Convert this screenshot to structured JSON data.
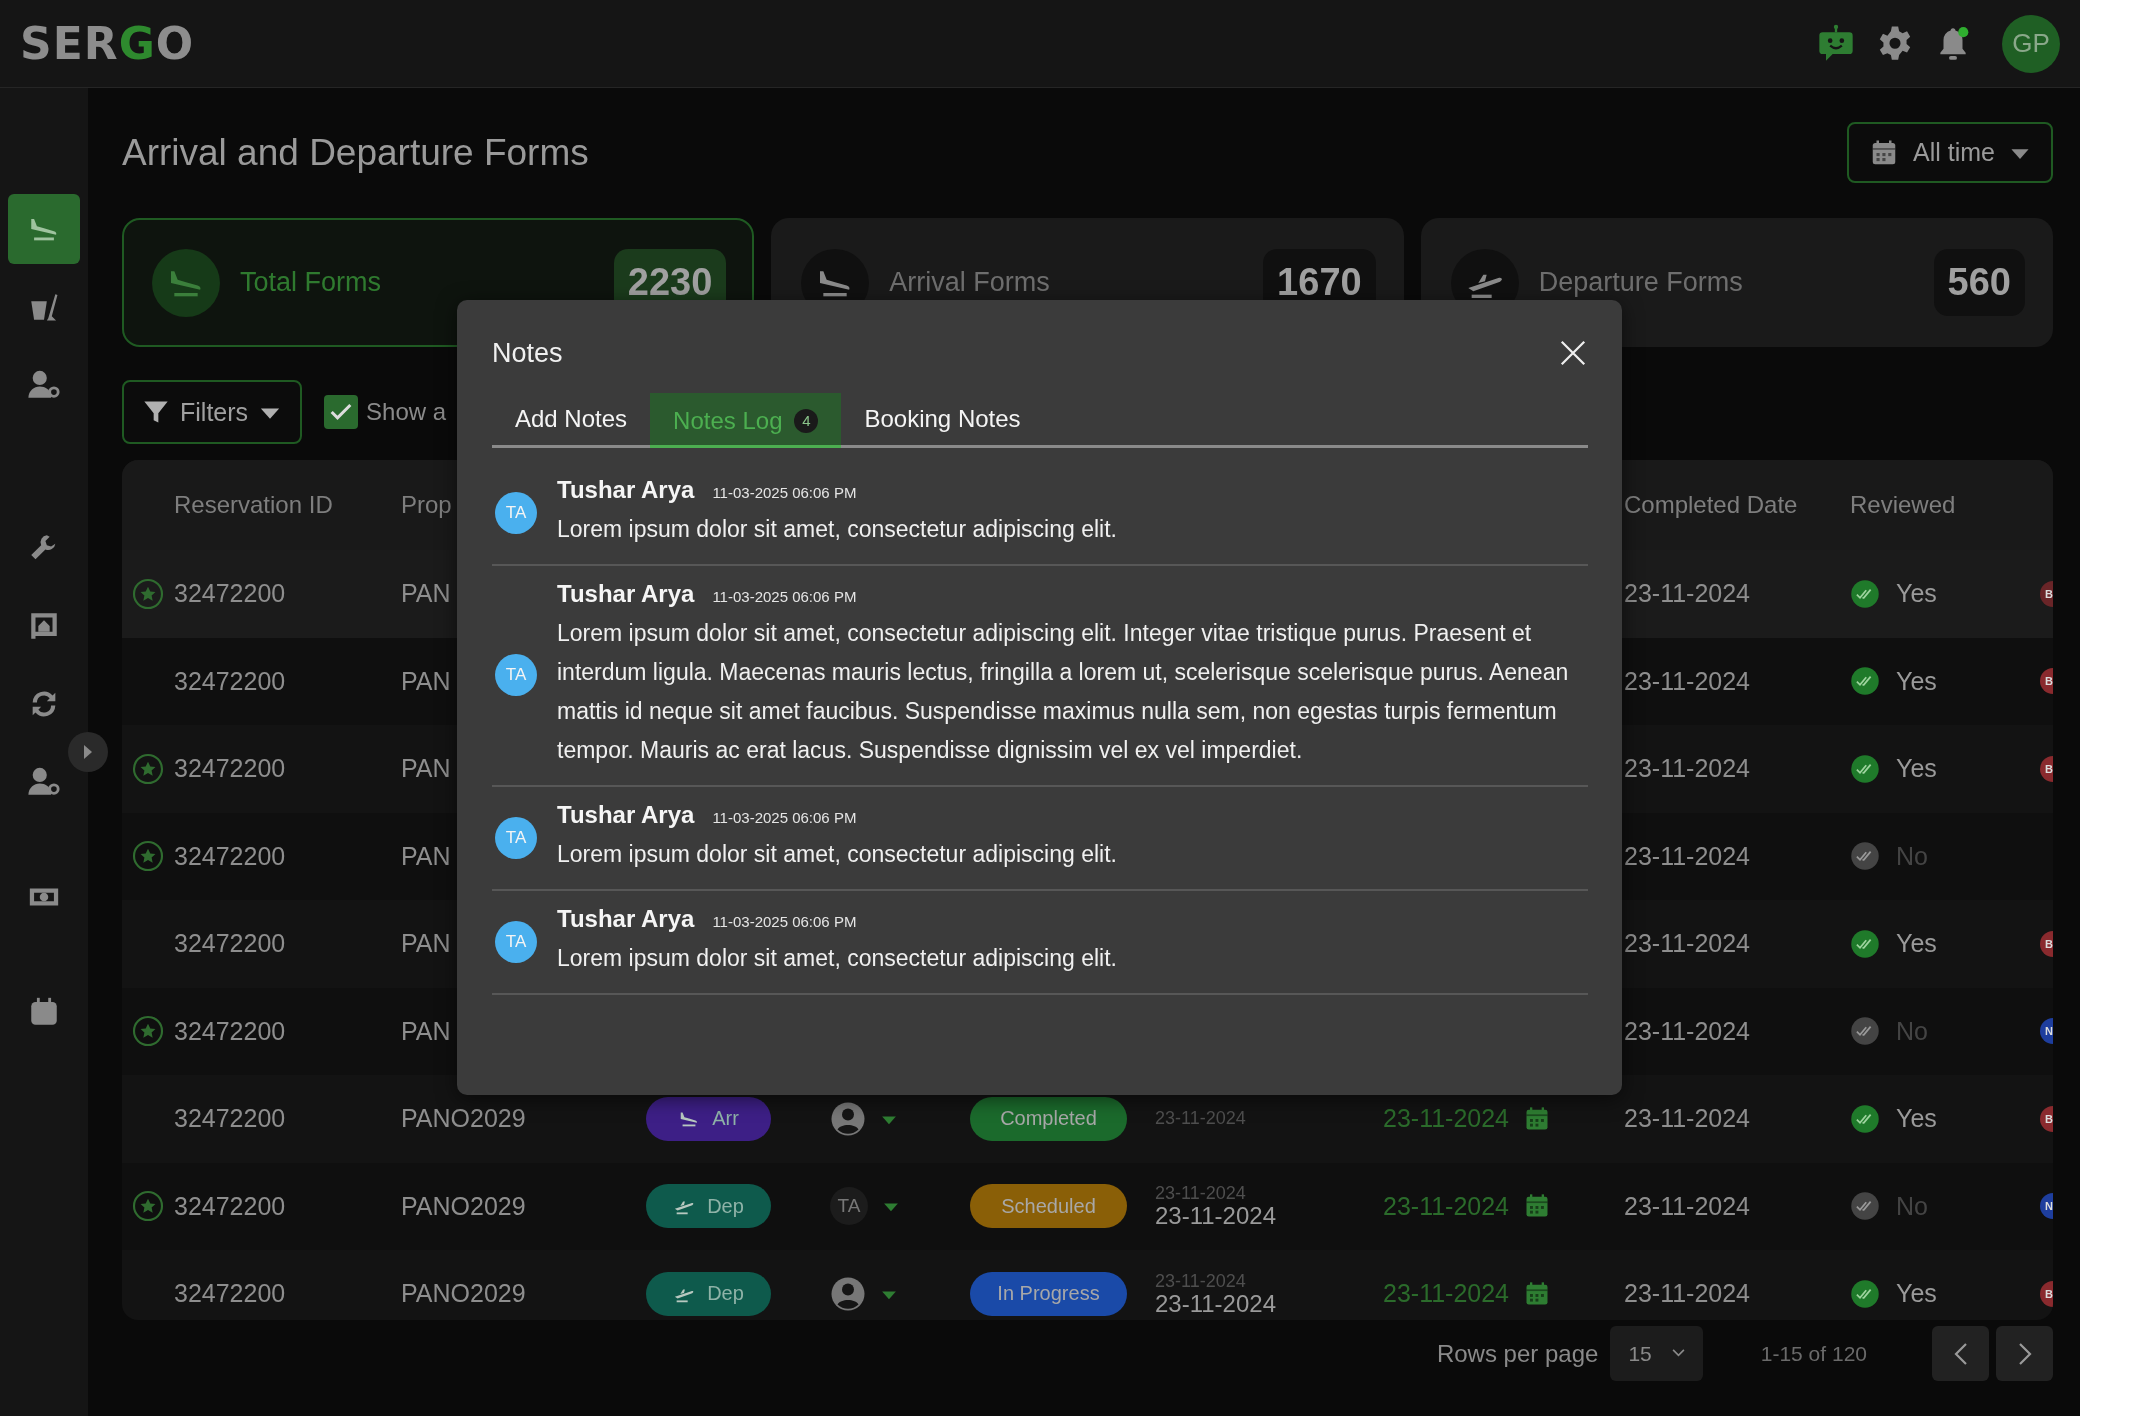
{
  "brand": {
    "logo_parts": [
      {
        "text": "SER",
        "accent": false
      },
      {
        "text": "G",
        "accent": true
      },
      {
        "text": "O",
        "accent": false
      }
    ]
  },
  "header": {
    "notification_dot": true,
    "user_initials": "GP"
  },
  "sidebar": {
    "groups": [
      [
        {
          "kind": "arrival",
          "selected": true
        },
        {
          "kind": "cleaning",
          "selected": false
        },
        {
          "kind": "staff",
          "selected": false
        }
      ],
      [
        {
          "kind": "maintenance",
          "selected": false
        },
        {
          "kind": "property",
          "selected": false
        },
        {
          "kind": "sync",
          "selected": false
        },
        {
          "kind": "staff",
          "selected": false
        }
      ],
      [
        {
          "kind": "payment",
          "selected": false
        }
      ],
      [
        {
          "kind": "calendar",
          "selected": false
        }
      ]
    ]
  },
  "page_title": "Arrival and Departure Forms",
  "date_filter": {
    "label": "All time"
  },
  "stats": [
    {
      "kind": "total",
      "label": "Total Forms",
      "count": "2230",
      "selected": true
    },
    {
      "kind": "arrival",
      "label": "Arrival Forms",
      "count": "1670",
      "selected": false
    },
    {
      "kind": "departure",
      "label": "Departure Forms",
      "count": "560",
      "selected": false
    }
  ],
  "toolbar": {
    "filters_label": "Filters",
    "show_all": {
      "label": "Show a",
      "checked": true
    }
  },
  "table": {
    "columns": [
      "Reservation ID",
      "Prop",
      "Completed Date",
      "Reviewed"
    ],
    "rows": [
      {
        "highlighted": true,
        "starred": true,
        "id": "32472200",
        "property": "PAN",
        "completed": "23-11-2024",
        "reviewed": {
          "label": "Yes",
          "checked": true
        },
        "badge": {
          "text": "B",
          "color": "#6a2528"
        }
      },
      {
        "highlighted": false,
        "starred": false,
        "id": "32472200",
        "property": "PAN",
        "completed": "23-11-2024",
        "reviewed": {
          "label": "Yes",
          "checked": true
        },
        "badge": {
          "text": "B",
          "color": "#8a2a2e"
        }
      },
      {
        "highlighted": false,
        "starred": true,
        "id": "32472200",
        "property": "PAN",
        "completed": "23-11-2024",
        "reviewed": {
          "label": "Yes",
          "checked": true
        },
        "badge": {
          "text": "B",
          "color": "#8a2a2e"
        }
      },
      {
        "highlighted": false,
        "starred": true,
        "id": "32472200",
        "property": "PAN",
        "completed": "23-11-2024",
        "reviewed": {
          "label": "No",
          "checked": false
        }
      },
      {
        "highlighted": false,
        "starred": false,
        "id": "32472200",
        "property": "PAN",
        "completed": "23-11-2024",
        "reviewed": {
          "label": "Yes",
          "checked": true
        },
        "badge": {
          "text": "B",
          "color": "#8a2a2e"
        }
      },
      {
        "highlighted": false,
        "starred": true,
        "id": "32472200",
        "property": "PAN",
        "completed": "23-11-2024",
        "reviewed": {
          "label": "No",
          "checked": false
        },
        "badge": {
          "text": "N",
          "color": "#1e3e9e"
        }
      },
      {
        "highlighted": false,
        "starred": false,
        "id": "32472200",
        "property": "PANO2029",
        "type": {
          "kind": "arrival",
          "label": "Arr",
          "color": "#3d1f86"
        },
        "assignee": {
          "kind": "person"
        },
        "status": {
          "label": "Completed",
          "color": "#1b6a2c"
        },
        "scheduled": {
          "sub": "23-11-2024"
        },
        "due": "23-11-2024",
        "completed": "23-11-2024",
        "reviewed": {
          "label": "Yes",
          "checked": true
        },
        "badge": {
          "text": "B",
          "color": "#8a2a2e"
        }
      },
      {
        "highlighted": false,
        "starred": true,
        "id": "32472200",
        "property": "PANO2029",
        "type": {
          "kind": "departure",
          "label": "Dep",
          "color": "#0e5a4c"
        },
        "assignee": {
          "kind": "initials",
          "text": "TA"
        },
        "status": {
          "label": "Scheduled",
          "color": "#8a5f07"
        },
        "scheduled": {
          "sub": "23-11-2024",
          "main": "23-11-2024"
        },
        "due": "23-11-2024",
        "completed": "23-11-2024",
        "reviewed": {
          "label": "No",
          "checked": false
        },
        "badge": {
          "text": "N",
          "color": "#1e3e9e"
        }
      },
      {
        "highlighted": false,
        "starred": false,
        "id": "32472200",
        "property": "PANO2029",
        "type": {
          "kind": "departure",
          "label": "Dep",
          "color": "#0e5a4c"
        },
        "assignee": {
          "kind": "person"
        },
        "status": {
          "label": "In Progress",
          "color": "#1a4aa8"
        },
        "scheduled": {
          "sub": "23-11-2024",
          "main": "23-11-2024"
        },
        "due": "23-11-2024",
        "completed": "23-11-2024",
        "reviewed": {
          "label": "Yes",
          "checked": true
        },
        "badge": {
          "text": "B",
          "color": "#8a2a2e"
        }
      }
    ]
  },
  "pagination": {
    "rows_per_page_label": "Rows per page",
    "rows_per_page": "15",
    "range": "1-15 of 120"
  },
  "modal": {
    "title": "Notes",
    "tabs": [
      {
        "label": "Add Notes",
        "selected": false
      },
      {
        "label": "Notes Log",
        "count": "4",
        "selected": true
      },
      {
        "label": "Booking Notes",
        "selected": false
      }
    ],
    "notes": [
      {
        "initials": "TA",
        "author": "Tushar Arya",
        "time": "11-03-2025 06:06 PM",
        "text": "Lorem ipsum dolor sit amet, consectetur adipiscing elit."
      },
      {
        "initials": "TA",
        "author": "Tushar Arya",
        "time": "11-03-2025 06:06 PM",
        "text": "Lorem ipsum dolor sit amet, consectetur adipiscing elit. Integer vitae tristique purus. Praesent et interdum ligula. Maecenas mauris lectus, fringilla a lorem ut, scelerisque scelerisque purus. Aenean mattis id neque sit amet faucibus. Suspendisse maximus nulla sem, non egestas turpis fermentum tempor. Mauris ac erat lacus. Suspendisse dignissim vel ex vel imperdiet."
      },
      {
        "initials": "TA",
        "author": "Tushar Arya",
        "time": "11-03-2025 06:06 PM",
        "text": "Lorem ipsum dolor sit amet, consectetur adipiscing elit."
      },
      {
        "initials": "TA",
        "author": "Tushar Arya",
        "time": "11-03-2025 06:06 PM",
        "text": "Lorem ipsum dolor sit amet, consectetur adipiscing elit."
      }
    ]
  }
}
